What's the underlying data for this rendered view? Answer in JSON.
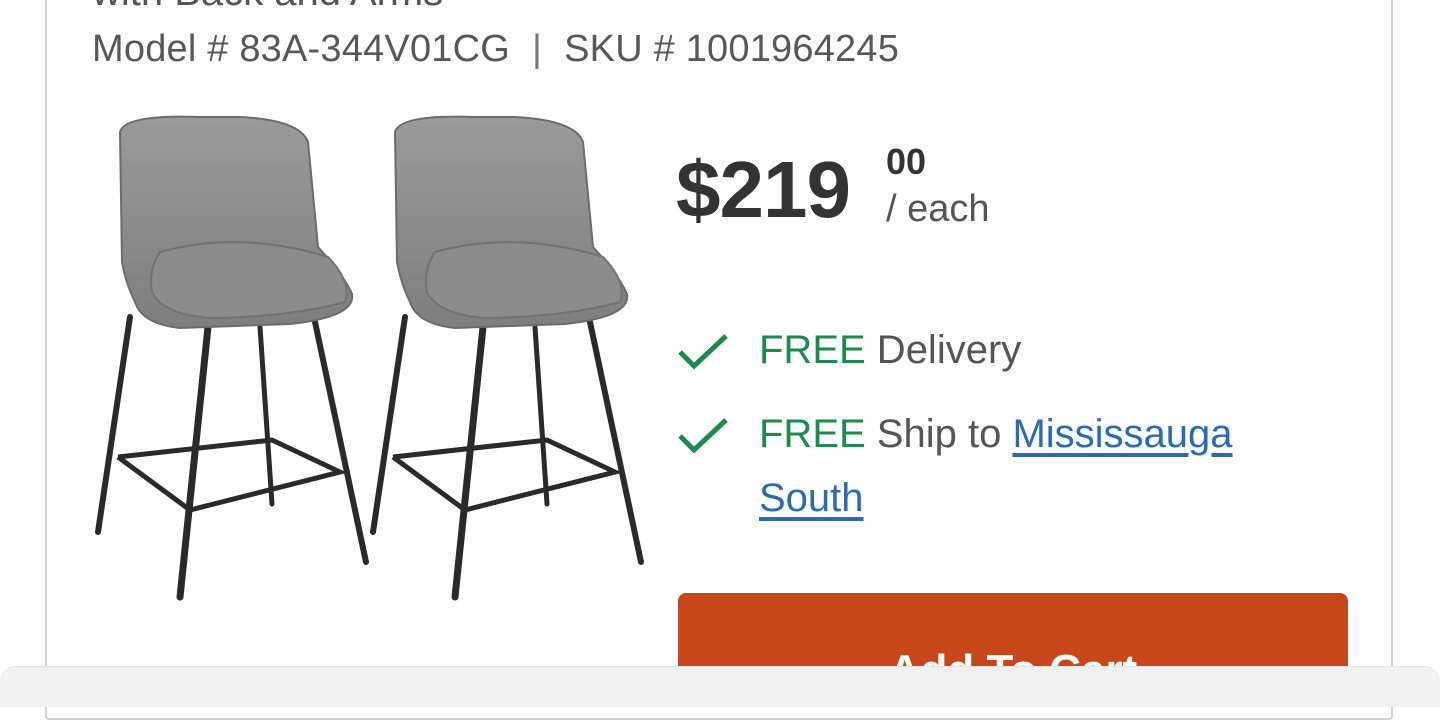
{
  "product": {
    "title_partial": "with Back and Arms",
    "model_label": "Model # 83A-344V01CG",
    "separator": "|",
    "sku_label": "SKU # 1001964245",
    "image_alt": "Two grey upholstered counter stools with black metal legs"
  },
  "price": {
    "dollars": "$219",
    "cents": "00",
    "unit": "/ each"
  },
  "fulfillment": {
    "delivery": {
      "free": "FREE",
      "text": " Delivery"
    },
    "ship": {
      "free": "FREE",
      "text": " Ship to ",
      "store_link": "Mississauga South"
    }
  },
  "actions": {
    "add_to_cart": "Add To Cart"
  },
  "colors": {
    "free_green": "#1e8a4c",
    "link_blue": "#2b6cb0",
    "cart_orange": "#c8471a"
  }
}
